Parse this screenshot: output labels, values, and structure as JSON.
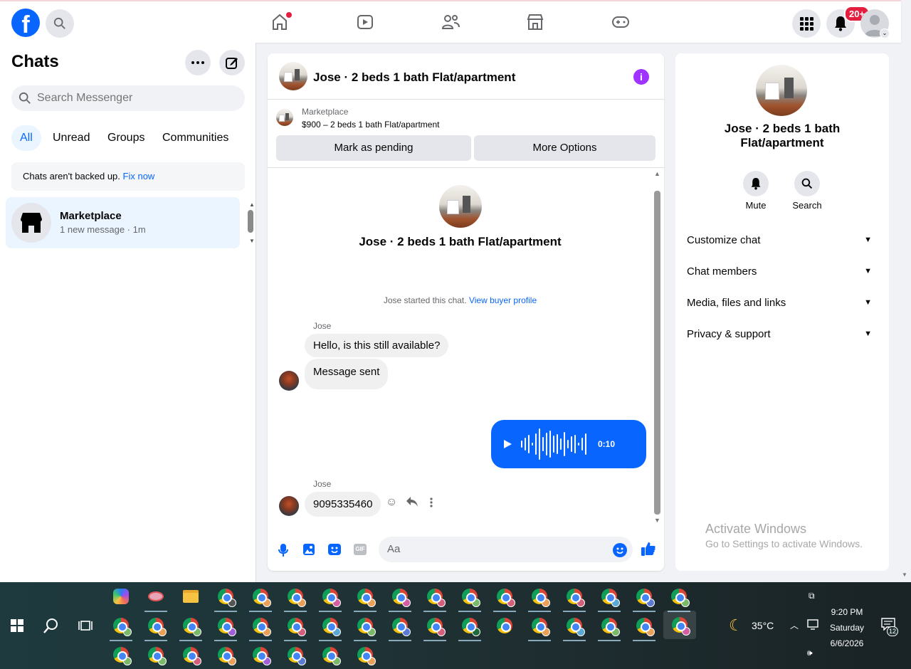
{
  "topbar": {
    "notif_badge": "20+"
  },
  "left": {
    "title": "Chats",
    "search_placeholder": "Search Messenger",
    "filters": [
      "All",
      "Unread",
      "Groups",
      "Communities"
    ],
    "backup_text": "Chats aren't backed up.",
    "backup_link": "Fix now",
    "chat_item": {
      "name": "Marketplace",
      "preview": "1 new message · 1m"
    }
  },
  "center": {
    "header_title": "Jose · 2 beds 1 bath Flat/apartment",
    "marketplace_label": "Marketplace",
    "listing": "$900 – 2 beds 1 bath Flat/apartment",
    "btn_pending": "Mark as pending",
    "btn_more": "More Options",
    "intro_title": "Jose · 2 beds 1 bath Flat/apartment",
    "started_text": "Jose started this chat.",
    "buyer_link": "View buyer profile",
    "sender1": "Jose",
    "msg1": "Hello, is this still available?",
    "msg2": "Message sent",
    "voice_time": "0:10",
    "sender2": "Jose",
    "msg3": "9095335460",
    "composer_placeholder": "Aa"
  },
  "right": {
    "title": "Jose · 2 beds 1 bath Flat/apartment",
    "mute": "Mute",
    "search": "Search",
    "sections": [
      "Customize chat",
      "Chat members",
      "Media, files and links",
      "Privacy & support"
    ]
  },
  "watermark": {
    "line1": "Activate Windows",
    "line2": "Go to Settings to activate Windows."
  },
  "taskbar": {
    "temp": "35°C",
    "time": "9:20 PM",
    "day": "Saturday",
    "date": "6/6/2026",
    "notif_count": "12"
  }
}
